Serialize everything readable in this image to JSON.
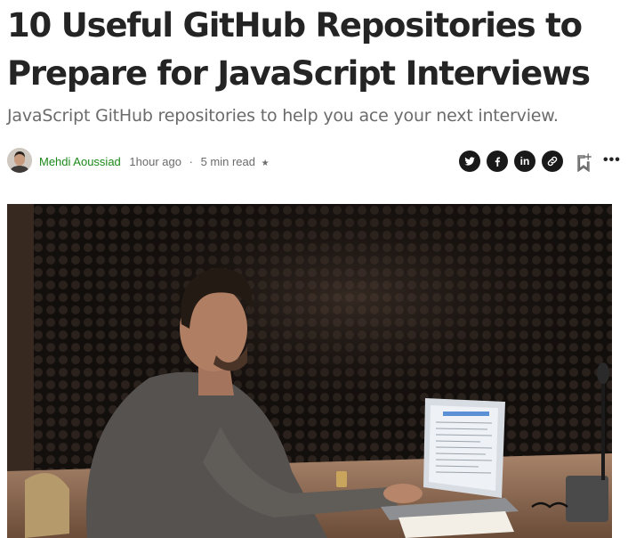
{
  "article": {
    "title": "10 Useful GitHub Repositories to Prepare for JavaScript Interviews",
    "subtitle": "JavaScript GitHub repositories to help you ace your next interview."
  },
  "byline": {
    "author": "Mehdi Aoussiad",
    "published": "1hour ago",
    "separator": "·",
    "read_time": "5 min read",
    "member_star": "★"
  },
  "share": {
    "icons": [
      "twitter-icon",
      "facebook-icon",
      "linkedin-icon",
      "copy-link-icon",
      "bookmark-add-icon",
      "more-options-icon"
    ],
    "linkedin_text": "in",
    "more_text": "•••"
  },
  "colors": {
    "text": "#242424",
    "secondary": "#6b6b6b",
    "author_green": "#1a8917",
    "icon_dark": "#191919"
  }
}
